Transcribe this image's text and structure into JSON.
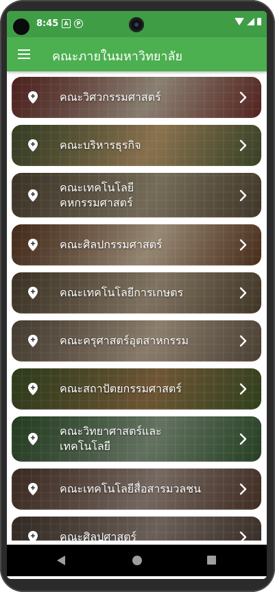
{
  "status_bar": {
    "time": "8:45",
    "icons": [
      "a-icon",
      "p-icon",
      "wifi-icon",
      "signal-icon",
      "battery-icon"
    ]
  },
  "app_bar": {
    "title": "คณะภายในมหาวิทยาลัย",
    "menu_icon": "hamburger-menu-icon"
  },
  "faculties": [
    {
      "lines": [
        "คณะวิศวกรรมศาสตร์"
      ],
      "bg": "#8a3a33",
      "bg2": "#c6b8a3"
    },
    {
      "lines": [
        "คณะบริหารธุรกิจ"
      ],
      "bg": "#5c6d3f",
      "bg2": "#c7a36f"
    },
    {
      "lines": [
        "คณะเทคโนโลยี",
        "คหกรรมศาสตร์"
      ],
      "bg": "#6b5b43",
      "bg2": "#a99b7f"
    },
    {
      "lines": [
        "คณะศิลปกรรมศาสตร์"
      ],
      "bg": "#7a4a2d",
      "bg2": "#d8c3a5"
    },
    {
      "lines": [
        "คณะเทคโนโลยีการเกษตร"
      ],
      "bg": "#6b5a40",
      "bg2": "#b8a58a"
    },
    {
      "lines": [
        "คณะครุศาสตร์อุตสาหกรรม"
      ],
      "bg": "#7b6a55",
      "bg2": "#c8b49a"
    },
    {
      "lines": [
        "คณะสถาปัตยกรรมศาสตร์"
      ],
      "bg": "#4f6a2f",
      "bg2": "#a07a4a"
    },
    {
      "lines": [
        "คณะวิทยาศาสตร์และ",
        "เทคโนโลยี"
      ],
      "bg": "#3f6b3a",
      "bg2": "#8fa58b"
    },
    {
      "lines": [
        "คณะเทคโนโลยีสื่อสารมวลชน"
      ],
      "bg": "#6a4a3a",
      "bg2": "#a8968a"
    },
    {
      "lines": [
        "คณะศิลปศาสตร์"
      ],
      "bg": "#5a4a3e",
      "bg2": "#9b8b80"
    }
  ],
  "colors": {
    "status_bar": "#3f9d46",
    "app_bar": "#4caf50",
    "nav_bar": "#000000"
  },
  "nav": {
    "back_icon": "back-triangle-icon",
    "home_icon": "home-circle-icon",
    "recent_icon": "recent-square-icon"
  }
}
